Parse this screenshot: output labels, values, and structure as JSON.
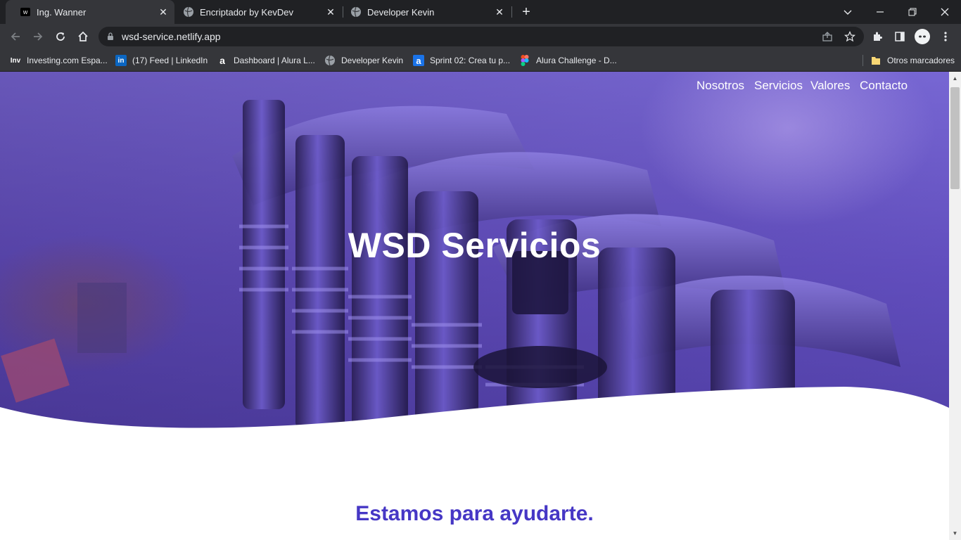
{
  "browser": {
    "tabs": [
      {
        "title": "Ing. Wanner",
        "icon": "site-logo-icon",
        "active": true
      },
      {
        "title": "Encriptador by KevDev",
        "icon": "globe-icon",
        "active": false
      },
      {
        "title": "Developer Kevin",
        "icon": "globe-icon",
        "active": false
      }
    ],
    "url": "wsd-service.netlify.app",
    "bookmarks": [
      {
        "label": "Investing.com Espa...",
        "icon": "investing-icon"
      },
      {
        "label": "(17) Feed | LinkedIn",
        "icon": "linkedin-icon"
      },
      {
        "label": "Dashboard | Alura L...",
        "icon": "alura-icon"
      },
      {
        "label": "Developer Kevin",
        "icon": "globe-icon"
      },
      {
        "label": "Sprint 02: Crea tu p...",
        "icon": "alura-icon"
      },
      {
        "label": "Alura Challenge - D...",
        "icon": "figma-icon"
      }
    ],
    "other_bookmarks": "Otros marcadores"
  },
  "site": {
    "nav": [
      "Nosotros",
      "Servicios",
      "Valores",
      "Contacto"
    ],
    "hero_title": "WSD Servicios",
    "section_title": "Estamos para ayudarte."
  },
  "colors": {
    "accent": "#4637c5",
    "hero_overlay": "#6a58d0"
  }
}
